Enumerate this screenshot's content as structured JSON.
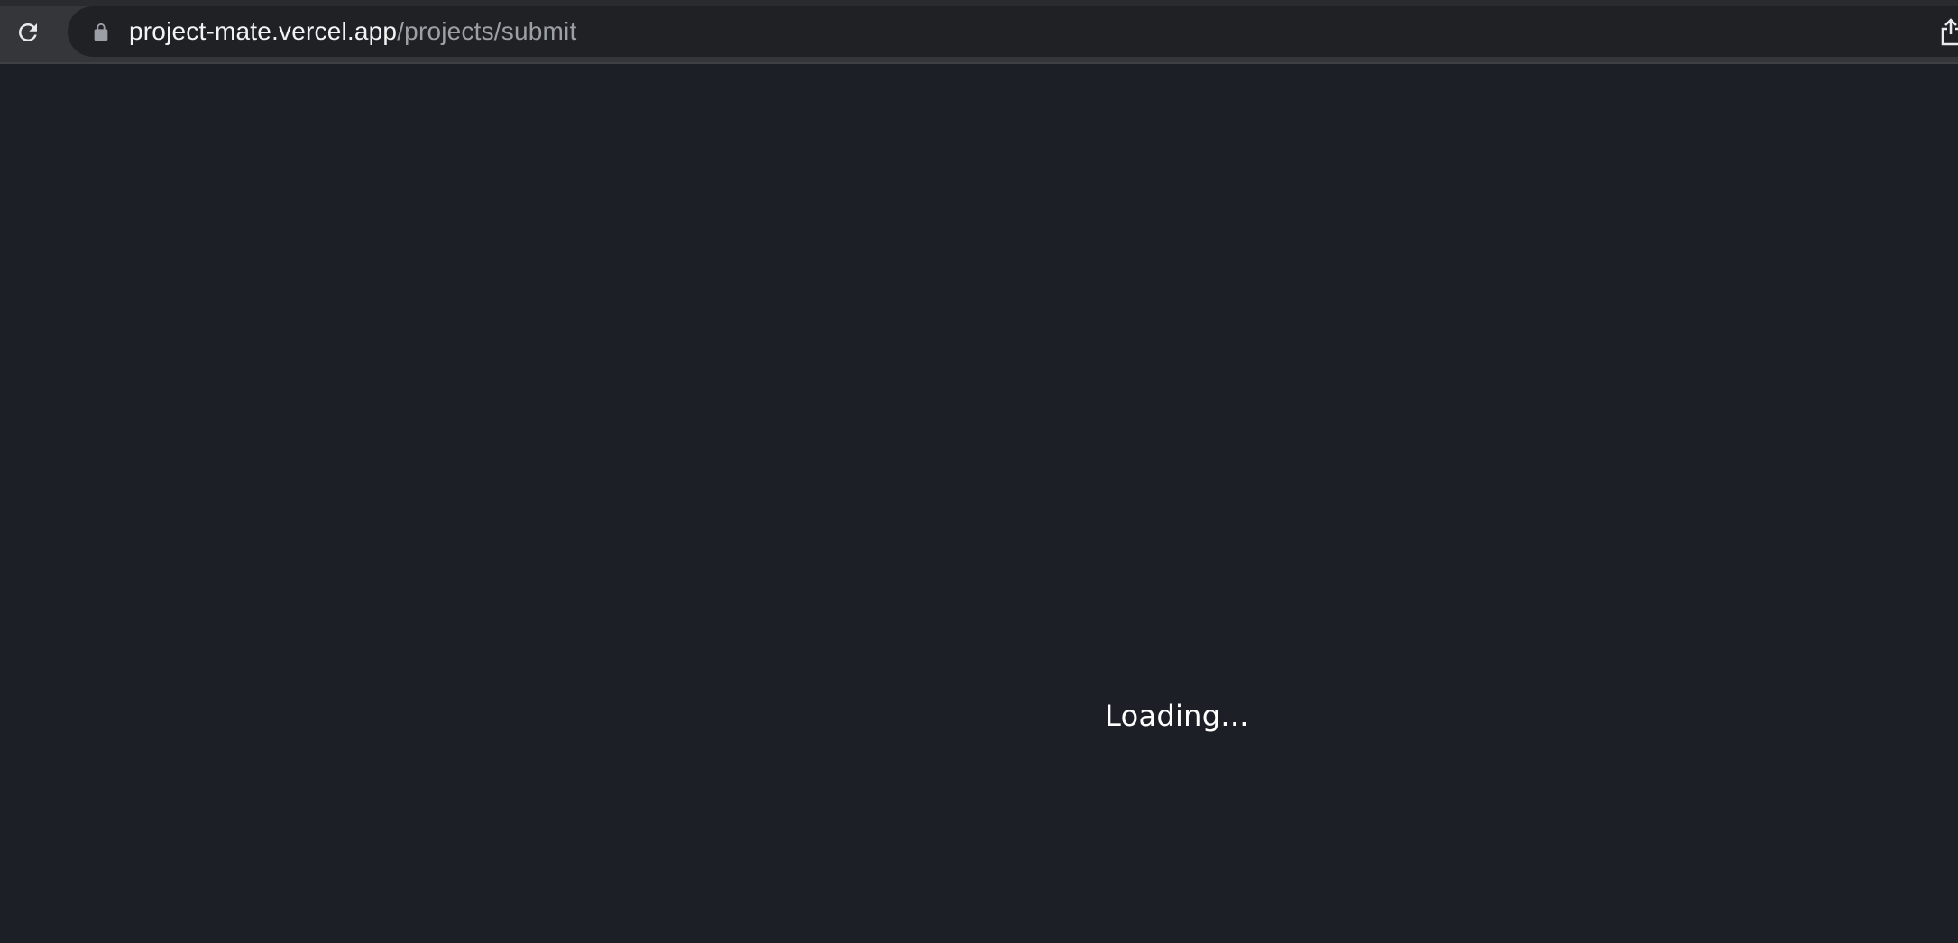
{
  "browser": {
    "url_host": "project-mate.vercel.app",
    "url_path": "/projects/submit",
    "icons": {
      "reload": "reload-icon",
      "lock": "lock-icon",
      "share": "share-icon"
    }
  },
  "page": {
    "loading_text": "Loading..."
  },
  "colors": {
    "page_background": "#1d1f27",
    "toolbar_background": "#35363a",
    "omnibox_background": "#202124",
    "url_host_color": "#f1f3f4",
    "url_path_color": "#9aa0a6",
    "text_color": "#ffffff"
  }
}
